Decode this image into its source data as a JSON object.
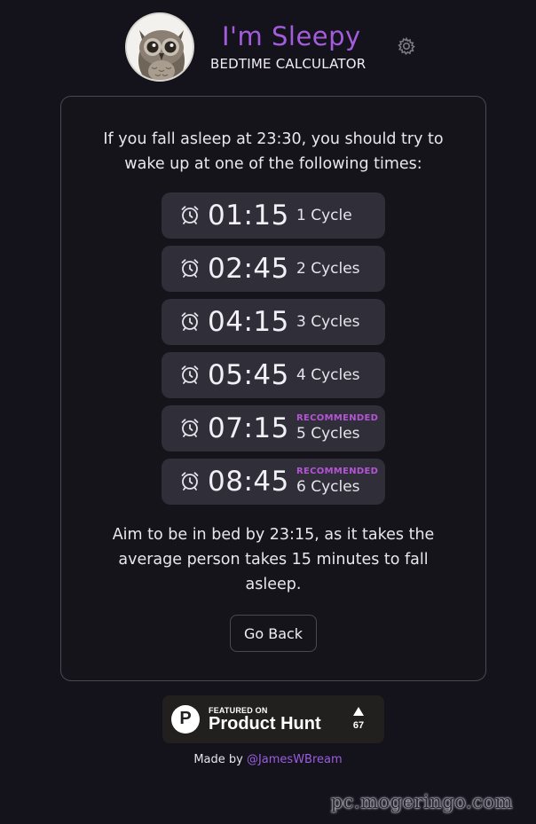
{
  "header": {
    "title": "I'm Sleepy",
    "subtitle": "BEDTIME CALCULATOR",
    "avatar_icon": "owl-icon",
    "settings_icon": "gear-icon"
  },
  "card": {
    "intro_line1": "If you fall asleep at 23:30, you should try to",
    "intro_line2": "wake up at one of the following times:",
    "times": [
      {
        "time": "01:15",
        "cycles": "1 Cycle",
        "recommended": ""
      },
      {
        "time": "02:45",
        "cycles": "2 Cycles",
        "recommended": ""
      },
      {
        "time": "04:15",
        "cycles": "3 Cycles",
        "recommended": ""
      },
      {
        "time": "05:45",
        "cycles": "4 Cycles",
        "recommended": ""
      },
      {
        "time": "07:15",
        "cycles": "5 Cycles",
        "recommended": "RECOMMENDED"
      },
      {
        "time": "08:45",
        "cycles": "6 Cycles",
        "recommended": "RECOMMENDED"
      }
    ],
    "aim_line1": "Aim to be in bed by 23:15, as it takes the",
    "aim_line2": "average person takes 15 minutes to fall",
    "aim_line3": "asleep.",
    "back_label": "Go Back"
  },
  "product_hunt": {
    "featured": "FEATURED ON",
    "name": "Product Hunt",
    "logo_letter": "P",
    "votes": "67"
  },
  "footer": {
    "made_by": "Made by",
    "author": "@JamesWBream"
  },
  "watermark": "pc.mogeringo.com",
  "colors": {
    "background": "#14121a",
    "accent": "#a35ddc",
    "recommended": "#b455d6",
    "time_row": "#302e38"
  }
}
